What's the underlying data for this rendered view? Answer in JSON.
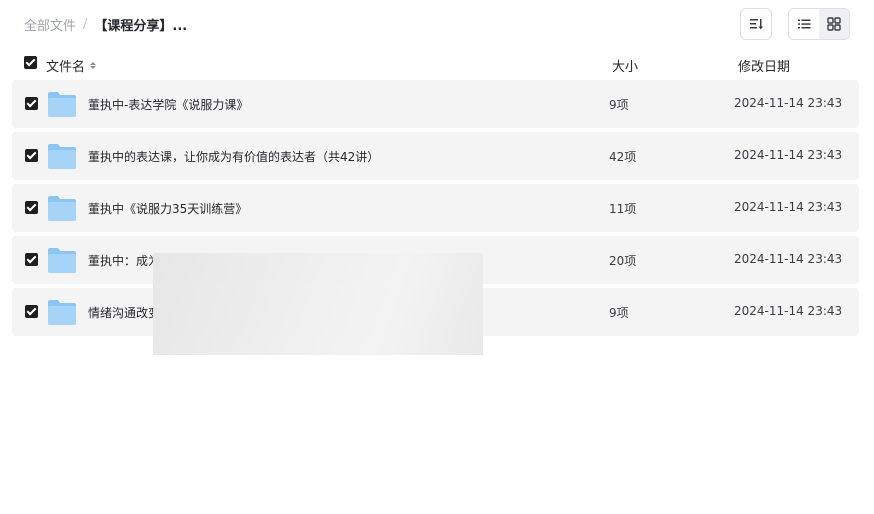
{
  "breadcrumb": {
    "root": "全部文件",
    "separator": "/",
    "current": "【课程分享】..."
  },
  "toolbar": {
    "sort_icon": "sort-icon",
    "list_view_icon": "list-view-icon",
    "grid_view_icon": "grid-view-icon",
    "active_view": "list"
  },
  "table": {
    "headers": {
      "name": "文件名",
      "size": "大小",
      "date": "修改日期"
    },
    "rows": [
      {
        "name": "董执中-表达学院《说服力课》",
        "size": "9项",
        "date": "2024-11-14 23:43"
      },
      {
        "name": "董执中的表达课，让你成为有价值的表达者（共42讲）",
        "size": "42项",
        "date": "2024-11-14 23:43"
      },
      {
        "name": "董执中《说服力35天训练营》",
        "size": "11项",
        "date": "2024-11-14 23:43"
      },
      {
        "name": "董执中：成为",
        "size": "20项",
        "date": "2024-11-14 23:43"
      },
      {
        "name": "情绪沟通改变",
        "size": "9项",
        "date": "2024-11-14 23:43"
      }
    ]
  },
  "colors": {
    "row_bg": "#f4f4f5",
    "folder": "#8cc4f4",
    "checkbox": "#1f1f1f"
  }
}
